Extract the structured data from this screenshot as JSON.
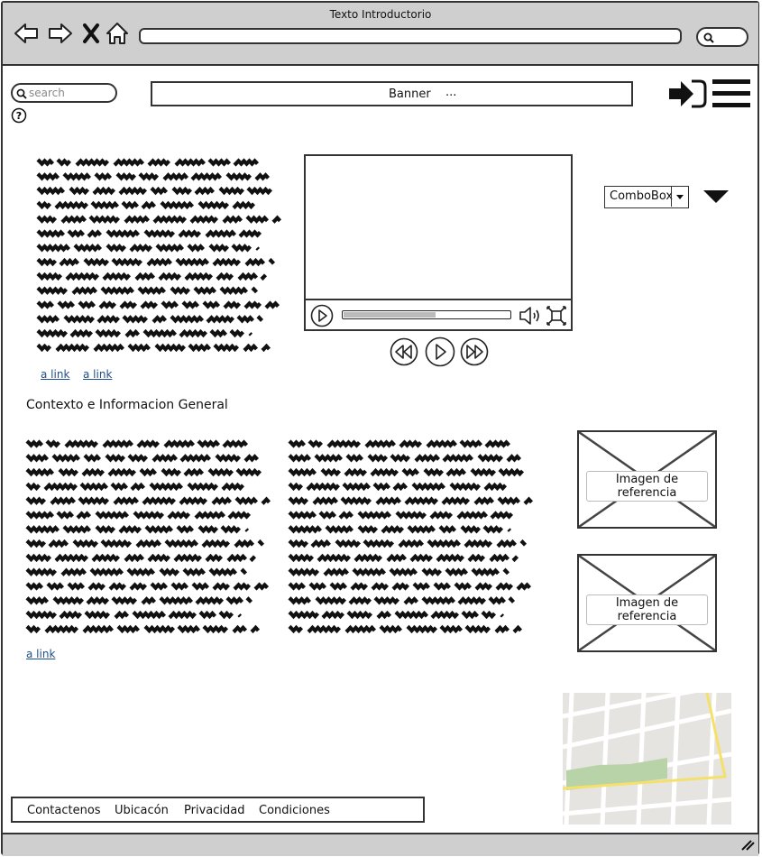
{
  "window": {
    "title": "Texto Introductorio"
  },
  "header": {
    "search_placeholder": "search",
    "banner_label": "Banner",
    "banner_extra": "..."
  },
  "intro": {
    "links": [
      "a link",
      "a link"
    ]
  },
  "combo": {
    "label": "ComboBox"
  },
  "section": {
    "title": "Contexto e Informacion General",
    "link": "a link"
  },
  "images": [
    {
      "caption": "Imagen de referencia"
    },
    {
      "caption": "Imagen de referencia"
    }
  ],
  "video": {
    "progress": 0.55
  },
  "footer": {
    "items": [
      "Contactenos",
      "Ubicacón",
      "Privacidad",
      "Condiciones"
    ]
  }
}
